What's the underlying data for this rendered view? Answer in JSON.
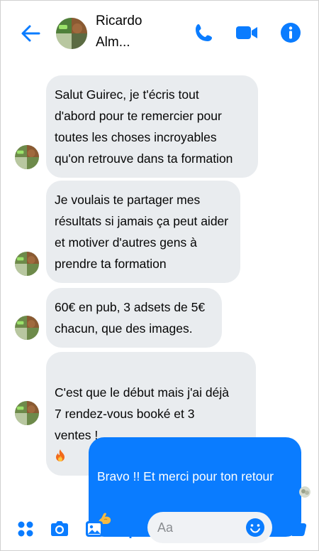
{
  "colors": {
    "accent": "#0a7cff",
    "incoming_bubble": "#e9ecef",
    "input_bg": "#f0f2f5"
  },
  "header": {
    "contact_name": "Ricardo Alm...",
    "icons": [
      "back-arrow-icon",
      "phone-icon",
      "video-call-icon",
      "info-icon"
    ]
  },
  "messages": [
    {
      "direction": "incoming",
      "text": "Salut Guirec, je t'écris tout\nd'abord pour te remercier pour\ntoutes les choses incroyables\nqu'on retrouve dans ta formation"
    },
    {
      "direction": "incoming",
      "text": "Je voulais te partager mes\nrésultats si jamais ça peut aider\net motiver d'autres gens à\nprendre ta formation"
    },
    {
      "direction": "incoming",
      "text": "60€ en pub, 3 adsets de 5€\nchacun, que des images."
    },
    {
      "direction": "incoming",
      "text": "C'est que le début mais j'ai déjà\n7 rendez-vous booké et 3\nventes !",
      "emoji": "fire-emoji"
    },
    {
      "direction": "outgoing",
      "text": "Bravo !! Et merci pour ton retour",
      "emoji": "flexed-biceps-emoji"
    }
  ],
  "composer": {
    "placeholder": "Aa",
    "icons": [
      "apps-icon",
      "camera-icon",
      "gallery-icon",
      "microphone-icon",
      "emoji-icon",
      "thumbs-up-icon"
    ]
  }
}
